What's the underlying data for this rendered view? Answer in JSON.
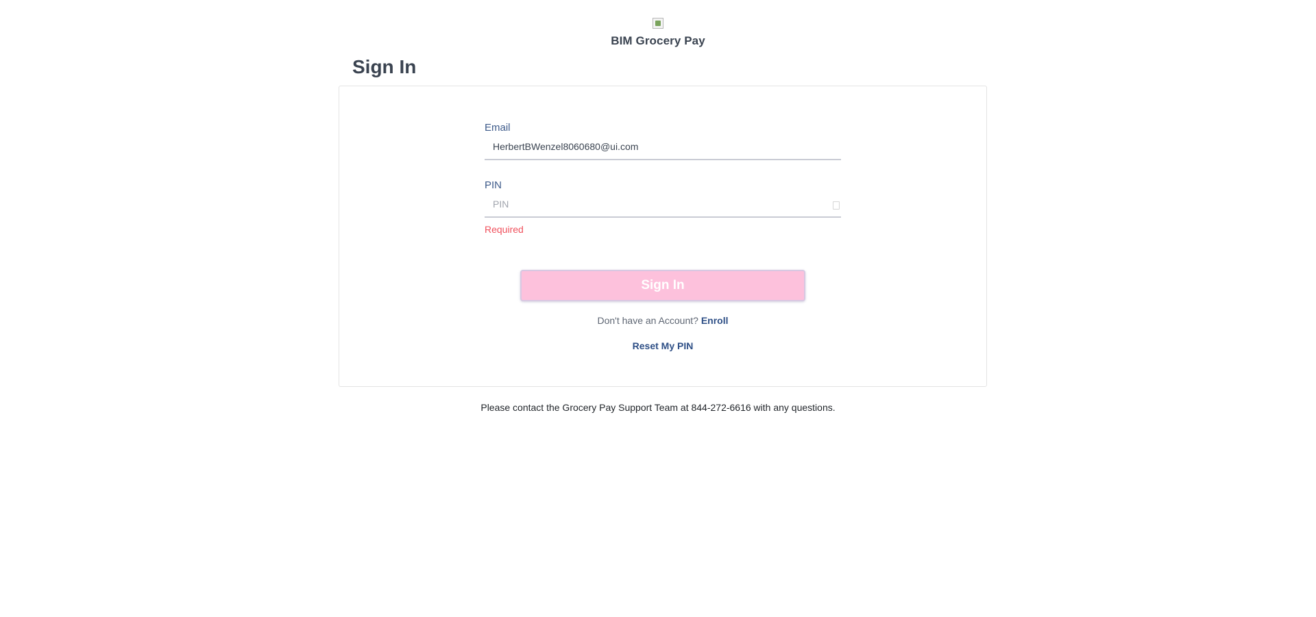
{
  "brand": {
    "name": "BIM Grocery Pay",
    "logo_icon": "broken-image-icon"
  },
  "page_title": "Sign In",
  "form": {
    "email": {
      "label": "Email",
      "value": "HerbertBWenzel8060680@ui.com"
    },
    "pin": {
      "label": "PIN",
      "placeholder": "PIN",
      "value": "",
      "error": "Required",
      "toggle_icon": "show-pin-icon"
    },
    "submit_label": "Sign In",
    "submit_color": "#fdc1dc"
  },
  "enroll": {
    "prompt": "Don't have an Account?",
    "link_label": "Enroll"
  },
  "reset_link_label": "Reset My PIN",
  "support_text": "Please contact the Grocery Pay Support Team at 844-272-6616 with any questions.",
  "colors": {
    "accent_text": "#2e4f86",
    "error": "#f0505c",
    "heading": "#3a4350"
  }
}
